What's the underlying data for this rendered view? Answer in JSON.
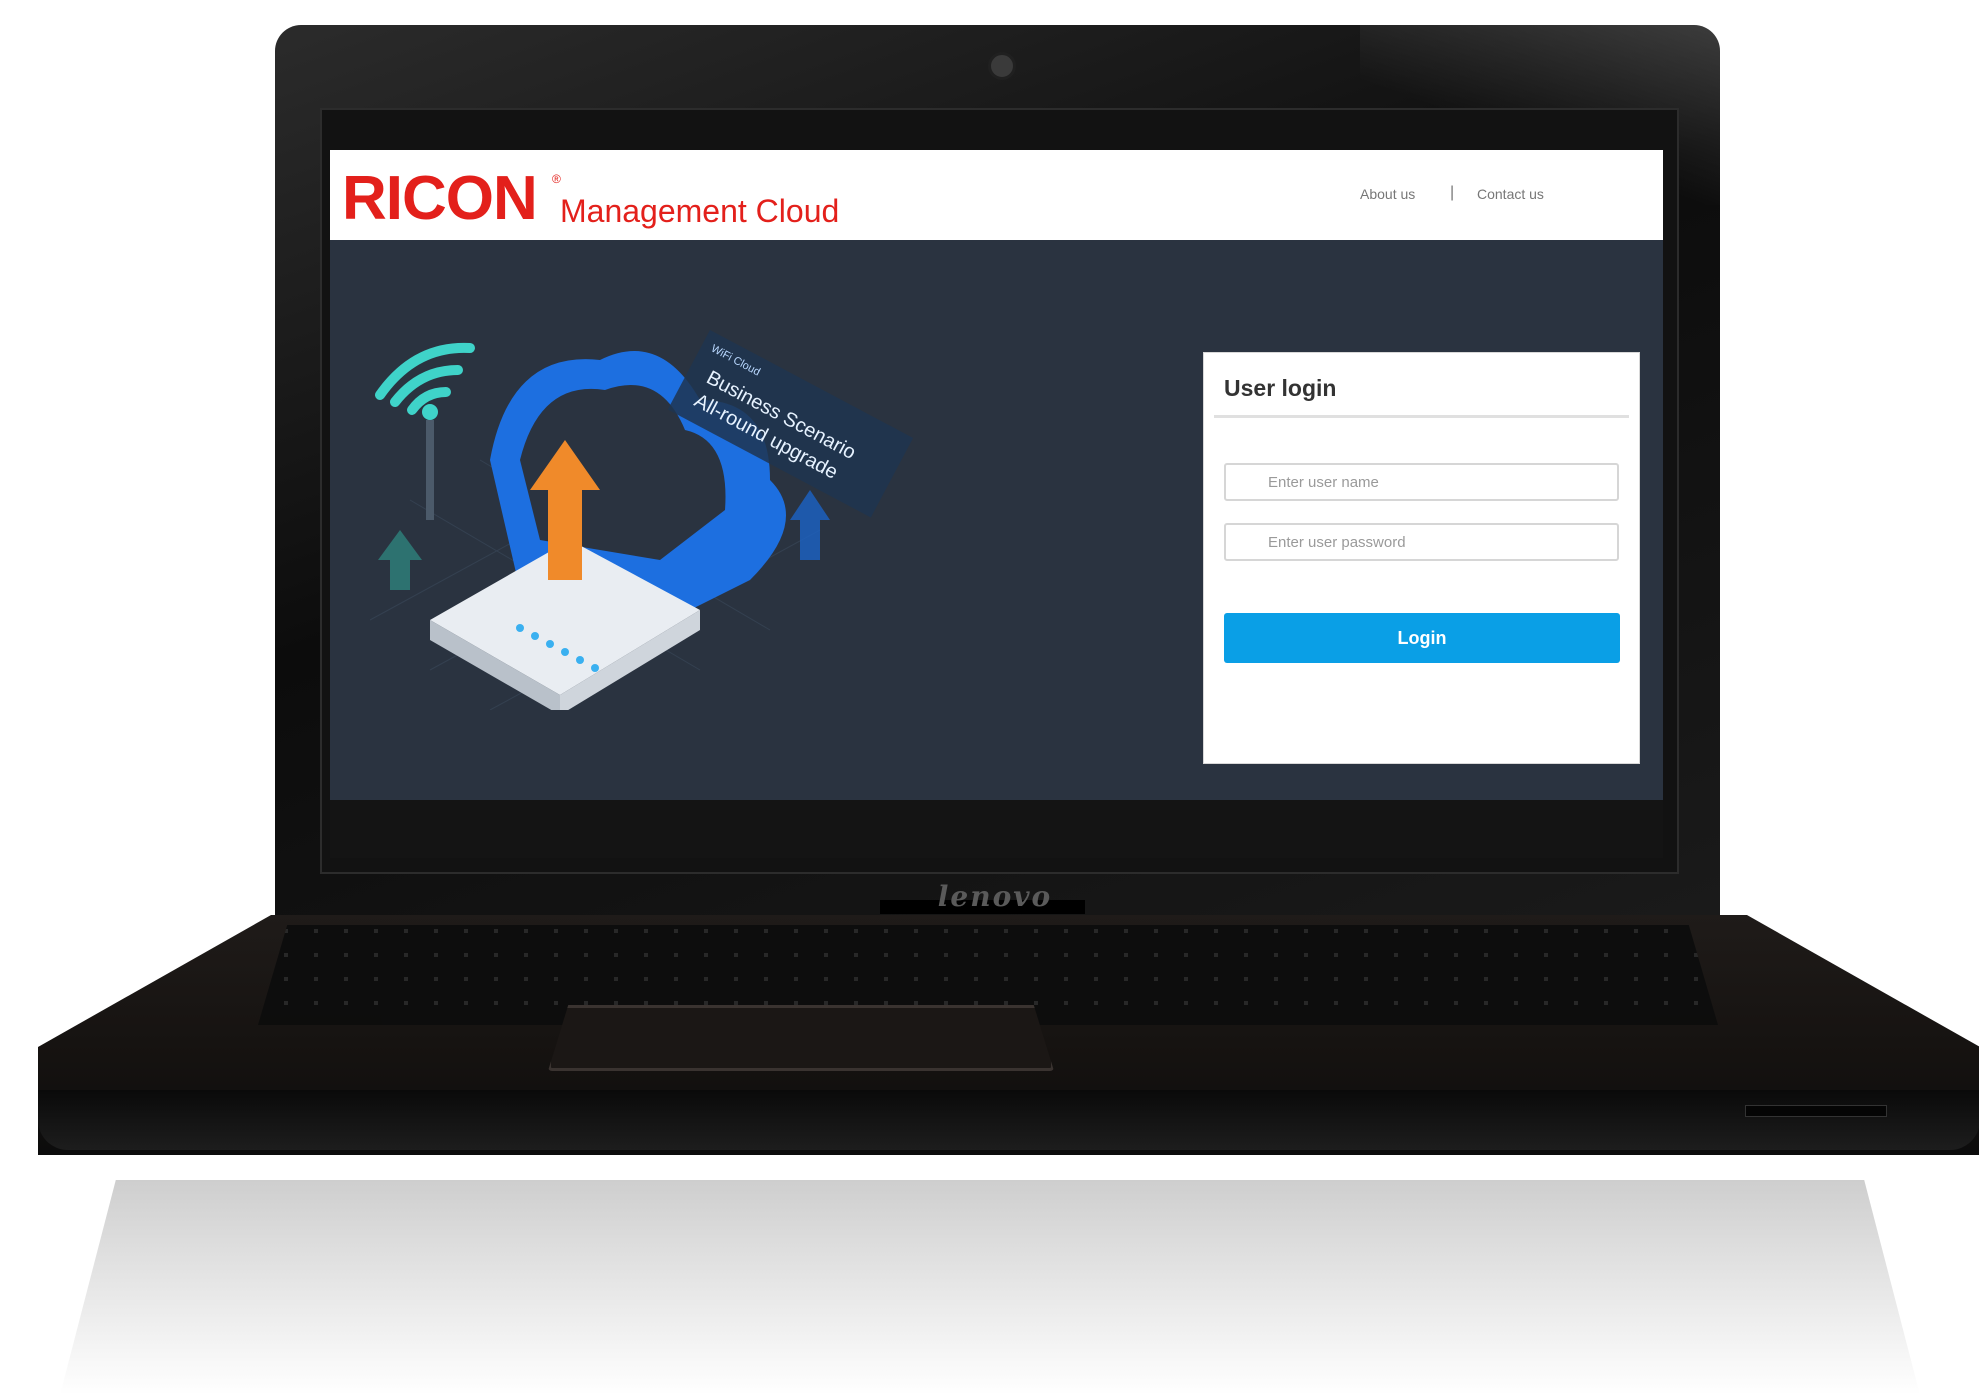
{
  "header": {
    "logo_text": "RICON",
    "logo_mark": "®",
    "logo_subtitle": "Management Cloud",
    "nav": [
      {
        "label": "About us"
      },
      {
        "label": "Contact us"
      }
    ],
    "nav_separator": "|"
  },
  "illustration": {
    "tag": "WiFi Cloud",
    "line1": "Business Scenario",
    "line2": "All-round upgrade"
  },
  "login": {
    "title": "User login",
    "username_placeholder": "Enter user name",
    "password_placeholder": "Enter user password",
    "button_label": "Login"
  },
  "device": {
    "brand": "lenovo"
  },
  "colors": {
    "brand_red": "#e3201b",
    "login_button": "#0a9fe6",
    "screen_background": "#2a3340"
  }
}
